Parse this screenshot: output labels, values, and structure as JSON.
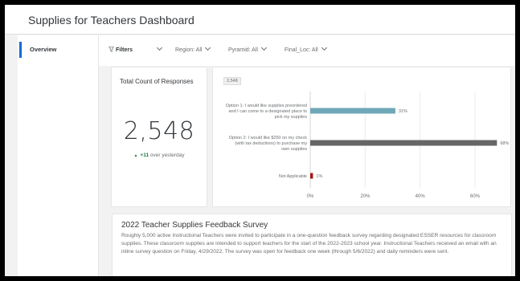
{
  "header": {
    "title": "Supplies for Teachers Dashboard"
  },
  "sidebar": {
    "items": [
      {
        "label": "Overview",
        "active": true
      }
    ]
  },
  "filters": {
    "filters_label": "Filters",
    "region": "Region: All",
    "pyramid": "Pyramid: All",
    "final_loc": "Final_Loc: All"
  },
  "kpi": {
    "label": "Total Count of Responses",
    "value": "2,548",
    "delta_value": "+11",
    "delta_text": "over yesterday",
    "delta_color": "#107e3e"
  },
  "chart_data": {
    "type": "bar",
    "orientation": "horizontal",
    "badge": "2,548",
    "categories": [
      "Option 1: I would like supplies preordered and I can come to a designated place to pick my supplies",
      "Option 2: I would like $250 on my check (with tax deductions) to purchase my own supplies",
      "Not Applicable"
    ],
    "values": [
      31,
      68,
      1
    ],
    "data_labels": [
      "31%",
      "68%",
      "1%"
    ],
    "colors": [
      "#6fa8b7",
      "#666666",
      "#a4161a"
    ],
    "xlim": [
      0,
      75
    ],
    "xticks": [
      0,
      20,
      40,
      60
    ],
    "xtick_labels": [
      "0%",
      "20%",
      "40%",
      "60%"
    ],
    "grid": true
  },
  "survey": {
    "title": "2022 Teacher Supplies Feedback Survey",
    "body": "Roughly 5,000 active Instructional Teachers were invited to participate in a one-question feedback survey regarding designated ESSER resources for classroom supplies. These classroom supplies are intended to support teachers for the start of the 2022-2023 school year. Instructional Teachers received an email with an inline survey question on Friday, 4/29/2022. The survey was open for feedback one week (through 5/6/2022) and daily reminders were sent."
  }
}
